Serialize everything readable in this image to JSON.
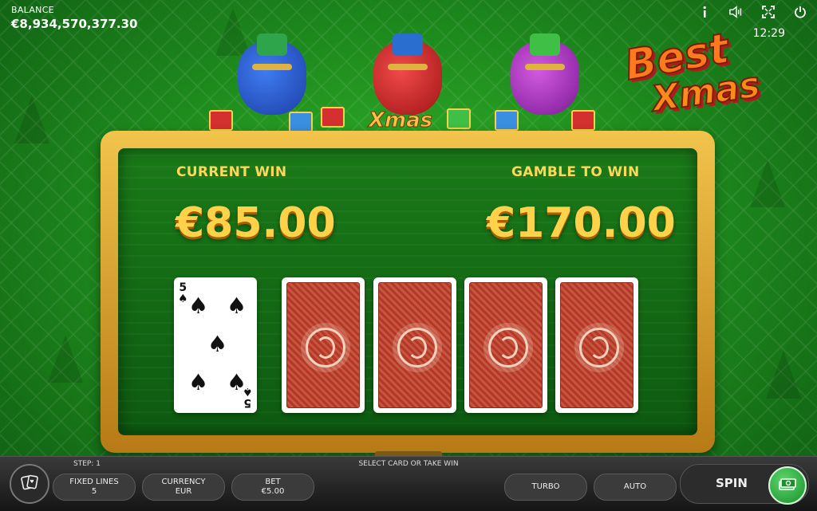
{
  "balance": {
    "label": "BALANCE",
    "value": "€8,934,570,377.30"
  },
  "clock": "12:29",
  "logo": {
    "line1": "Best",
    "line2": "Xmas"
  },
  "banner": {
    "text": "Xmas"
  },
  "board": {
    "current_win": {
      "label": "CURRENT WIN",
      "amount": "€85.00"
    },
    "gamble_to_win": {
      "label": "GAMBLE TO WIN",
      "amount": "€170.00"
    }
  },
  "dealer_card": {
    "rank": "5",
    "suit": "spades",
    "suit_symbol": "♠"
  },
  "bottom": {
    "step": "STEP: 1",
    "hint": "SELECT CARD OR TAKE WIN",
    "fixed_lines": {
      "label": "FIXED LINES",
      "value": "5"
    },
    "currency": {
      "label": "CURRENCY",
      "value": "EUR"
    },
    "bet": {
      "label": "BET",
      "value": "€5.00"
    },
    "turbo": "TURBO",
    "auto": "AUTO",
    "spin": "SPIN"
  },
  "icons": [
    "info-icon",
    "sound-icon",
    "fullscreen-icon",
    "power-icon",
    "cards-icon",
    "cash-icon"
  ],
  "colors": {
    "accent_gold": "#ffd24a",
    "table_green": "#1a7a18",
    "card_back": "#b3382a"
  }
}
